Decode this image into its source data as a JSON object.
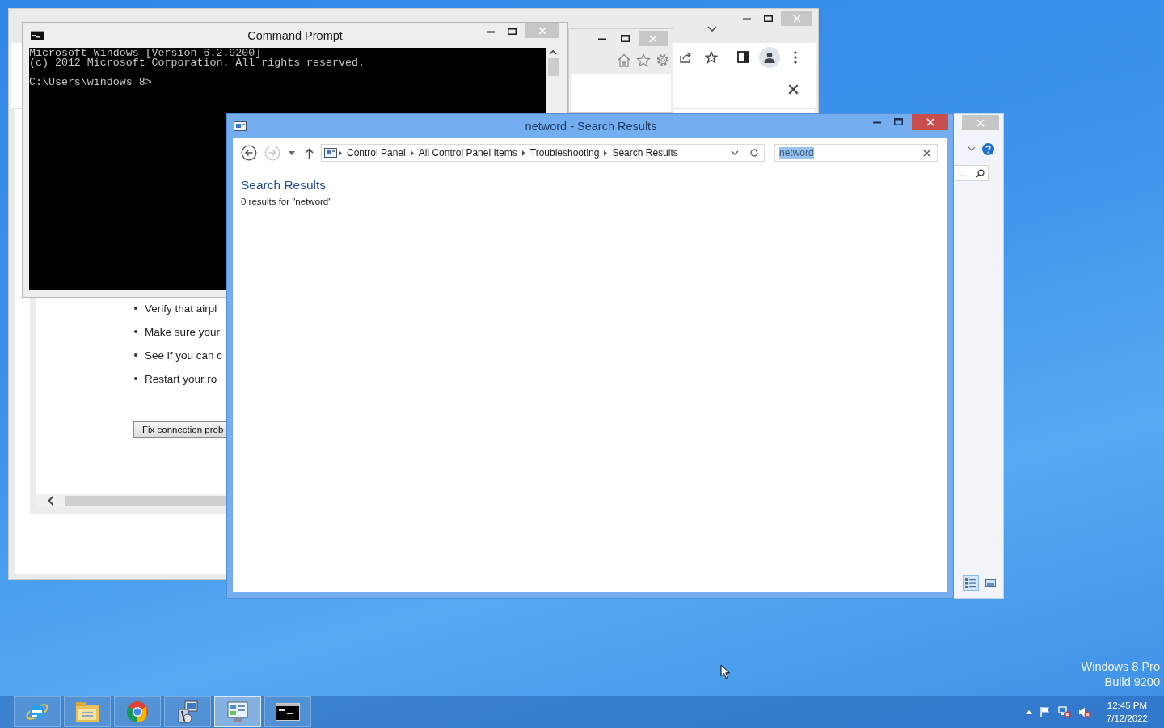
{
  "troubleshooter": {
    "bullets": [
      "Verify that airpl",
      "Make sure your",
      "See if you can c",
      "Restart your ro"
    ],
    "button": "Fix connection prob"
  },
  "command_prompt": {
    "title": "Command Prompt",
    "output": [
      "Microsoft Windows [Version 6.2.9200]",
      "(c) 2012 Microsoft Corporation. All rights reserved."
    ],
    "prompt": "C:\\Users\\windows 8>"
  },
  "explorer": {
    "title": "netword - Search Results",
    "breadcrumbs": [
      "Control Panel",
      "All Control Panel Items",
      "Troubleshooting",
      "Search Results"
    ],
    "search": {
      "value": "netword",
      "highlighted": true
    },
    "heading": "Search Results",
    "summary": "0 results for \"netword\""
  },
  "side_window": {
    "search": {
      "value": "..."
    },
    "views": [
      {
        "kind": "details",
        "selected": true
      },
      {
        "kind": "tiles",
        "selected": false
      }
    ]
  },
  "desktop": {
    "watermark": [
      "Windows 8 Pro",
      "Build 9200"
    ]
  },
  "taskbar": {
    "apps": [
      {
        "kind": "ie",
        "selected": false
      },
      {
        "kind": "explorer",
        "selected": false
      },
      {
        "kind": "chrome",
        "selected": false
      },
      {
        "kind": "installer",
        "selected": false
      },
      {
        "kind": "control-panel",
        "selected": true
      },
      {
        "kind": "cmd",
        "selected": false
      }
    ],
    "clock": {
      "time": "12:45 PM",
      "date": "7/12/2022"
    }
  }
}
